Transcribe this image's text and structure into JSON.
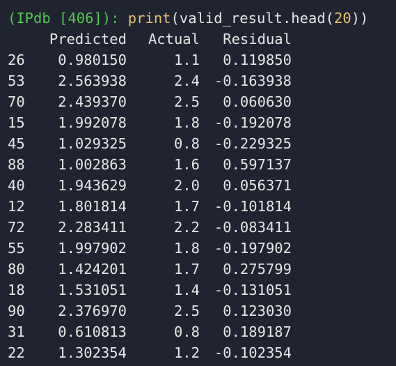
{
  "prompt": {
    "label": "(IPdb [406]):",
    "function": "print",
    "open_paren": "(",
    "argument": "valid_result.head(",
    "number": "20",
    "close_parens": "))"
  },
  "table": {
    "columns": [
      "Predicted",
      "Actual",
      "Residual"
    ],
    "rows": [
      {
        "index": "26",
        "predicted": "0.980150",
        "actual": "1.1",
        "residual": "0.119850"
      },
      {
        "index": "53",
        "predicted": "2.563938",
        "actual": "2.4",
        "residual": "-0.163938"
      },
      {
        "index": "70",
        "predicted": "2.439370",
        "actual": "2.5",
        "residual": "0.060630"
      },
      {
        "index": "15",
        "predicted": "1.992078",
        "actual": "1.8",
        "residual": "-0.192078"
      },
      {
        "index": "45",
        "predicted": "1.029325",
        "actual": "0.8",
        "residual": "-0.229325"
      },
      {
        "index": "88",
        "predicted": "1.002863",
        "actual": "1.6",
        "residual": "0.597137"
      },
      {
        "index": "40",
        "predicted": "1.943629",
        "actual": "2.0",
        "residual": "0.056371"
      },
      {
        "index": "12",
        "predicted": "1.801814",
        "actual": "1.7",
        "residual": "-0.101814"
      },
      {
        "index": "72",
        "predicted": "2.283411",
        "actual": "2.2",
        "residual": "-0.083411"
      },
      {
        "index": "55",
        "predicted": "1.997902",
        "actual": "1.8",
        "residual": "-0.197902"
      },
      {
        "index": "80",
        "predicted": "1.424201",
        "actual": "1.7",
        "residual": "0.275799"
      },
      {
        "index": "18",
        "predicted": "1.531051",
        "actual": "1.4",
        "residual": "-0.131051"
      },
      {
        "index": "90",
        "predicted": "2.376970",
        "actual": "2.5",
        "residual": "0.123030"
      },
      {
        "index": "31",
        "predicted": "0.610813",
        "actual": "0.8",
        "residual": "0.189187"
      },
      {
        "index": "22",
        "predicted": "1.302354",
        "actual": "1.2",
        "residual": "-0.102354"
      }
    ]
  },
  "colors": {
    "background": "#1f2430",
    "prompt": "#4ec94e",
    "function": "#e8c06b",
    "text": "#e6e6e6"
  }
}
